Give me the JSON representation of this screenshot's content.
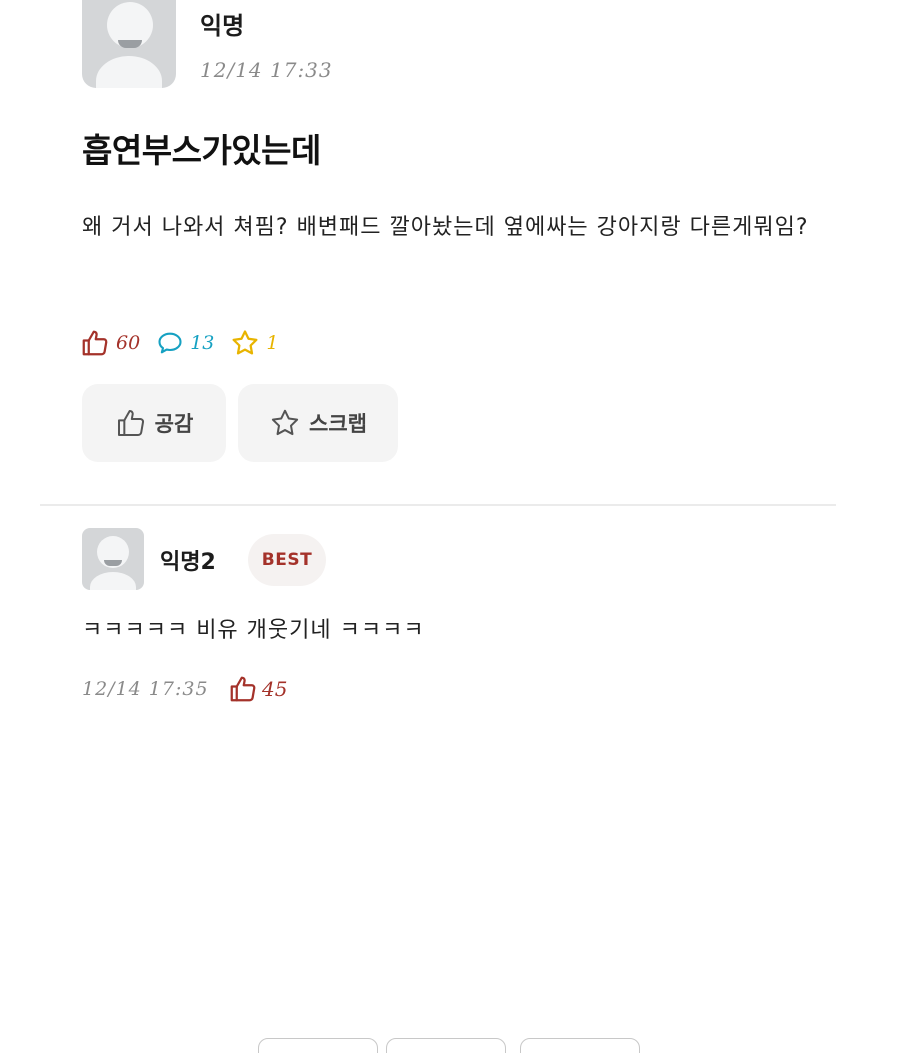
{
  "post": {
    "author": "익명",
    "time": "12/14 17:33",
    "title": "흡연부스가있는데",
    "body": "왜 거서 나와서 쳐핌? 배변패드 깔아놨는데 옆에싸는 강아지랑 다른게뭐임?",
    "stats": {
      "likes": "60",
      "comments": "13",
      "scraps": "1"
    },
    "actions": {
      "empathy_label": "공감",
      "scrap_label": "스크랩"
    }
  },
  "comment": {
    "author": "익명2",
    "badge": "BEST",
    "text": "ㅋㅋㅋㅋㅋ 비유 개웃기네 ㅋㅋㅋㅋ",
    "time": "12/14 17:35",
    "likes": "45"
  },
  "colors": {
    "like": "#a4322a",
    "comment": "#16a1c2",
    "scrap": "#e8b400",
    "avatar_bg": "#d4d6d8",
    "button_bg": "#f4f4f4"
  },
  "icons": [
    "avatar-placeholder",
    "thumbs-up-icon",
    "speech-bubble-icon",
    "star-icon"
  ]
}
